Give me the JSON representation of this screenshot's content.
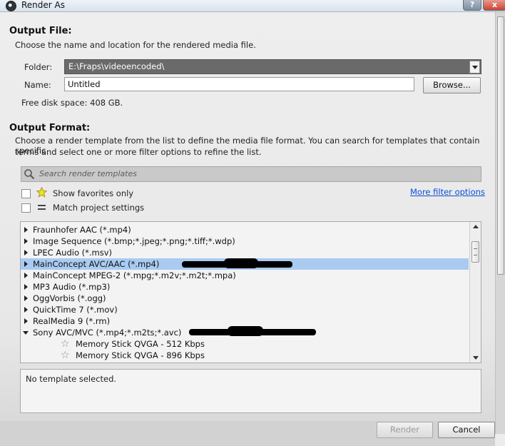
{
  "window": {
    "title": "Render As",
    "help_label": "?",
    "close_label": "x"
  },
  "output_file": {
    "heading": "Output File:",
    "description": "Choose the name and location for the rendered media file.",
    "folder_label": "Folder:",
    "folder_value": "E:\\Fraps\\videoencoded\\",
    "name_label": "Name:",
    "name_value": "Untitled",
    "browse_label": "Browse...",
    "free_space": "Free disk space: 408 GB."
  },
  "output_format": {
    "heading": "Output Format:",
    "description_line1": "Choose a render template from the list to define the media file format. You can search for templates that contain specific",
    "description_line2": "terms and select one or more filter options to refine the list.",
    "search_placeholder": "Search render templates",
    "show_favorites_label": "Show favorites only",
    "match_project_label": "Match project settings",
    "more_filter_label": "More filter options"
  },
  "templates": [
    {
      "label": "Fraunhofer AAC (*.mp4)",
      "expanded": false,
      "selected": false
    },
    {
      "label": "Image Sequence (*.bmp;*.jpeg;*.png;*.tiff;*.wdp)",
      "expanded": false,
      "selected": false
    },
    {
      "label": "LPEC Audio (*.msv)",
      "expanded": false,
      "selected": false
    },
    {
      "label": "MainConcept AVC/AAC (*.mp4)",
      "expanded": false,
      "selected": true
    },
    {
      "label": "MainConcept MPEG-2 (*.mpg;*.m2v;*.m2t;*.mpa)",
      "expanded": false,
      "selected": false
    },
    {
      "label": "MP3 Audio (*.mp3)",
      "expanded": false,
      "selected": false
    },
    {
      "label": "OggVorbis (*.ogg)",
      "expanded": false,
      "selected": false
    },
    {
      "label": "QuickTime 7 (*.mov)",
      "expanded": false,
      "selected": false
    },
    {
      "label": "RealMedia 9 (*.rm)",
      "expanded": false,
      "selected": false
    },
    {
      "label": "Sony AVC/MVC (*.mp4;*.m2ts;*.avc)",
      "expanded": true,
      "selected": false
    },
    {
      "label": "Memory Stick QVGA - 512 Kbps",
      "child": true
    },
    {
      "label": "Memory Stick QVGA - 896 Kbps",
      "child": true
    }
  ],
  "details": {
    "text": "No template selected."
  },
  "footer": {
    "render_label": "Render",
    "cancel_label": "Cancel"
  },
  "colors": {
    "selection": "#a9cbf2",
    "link": "#0b4fd6",
    "folder_bg": "#6a6a6a"
  }
}
